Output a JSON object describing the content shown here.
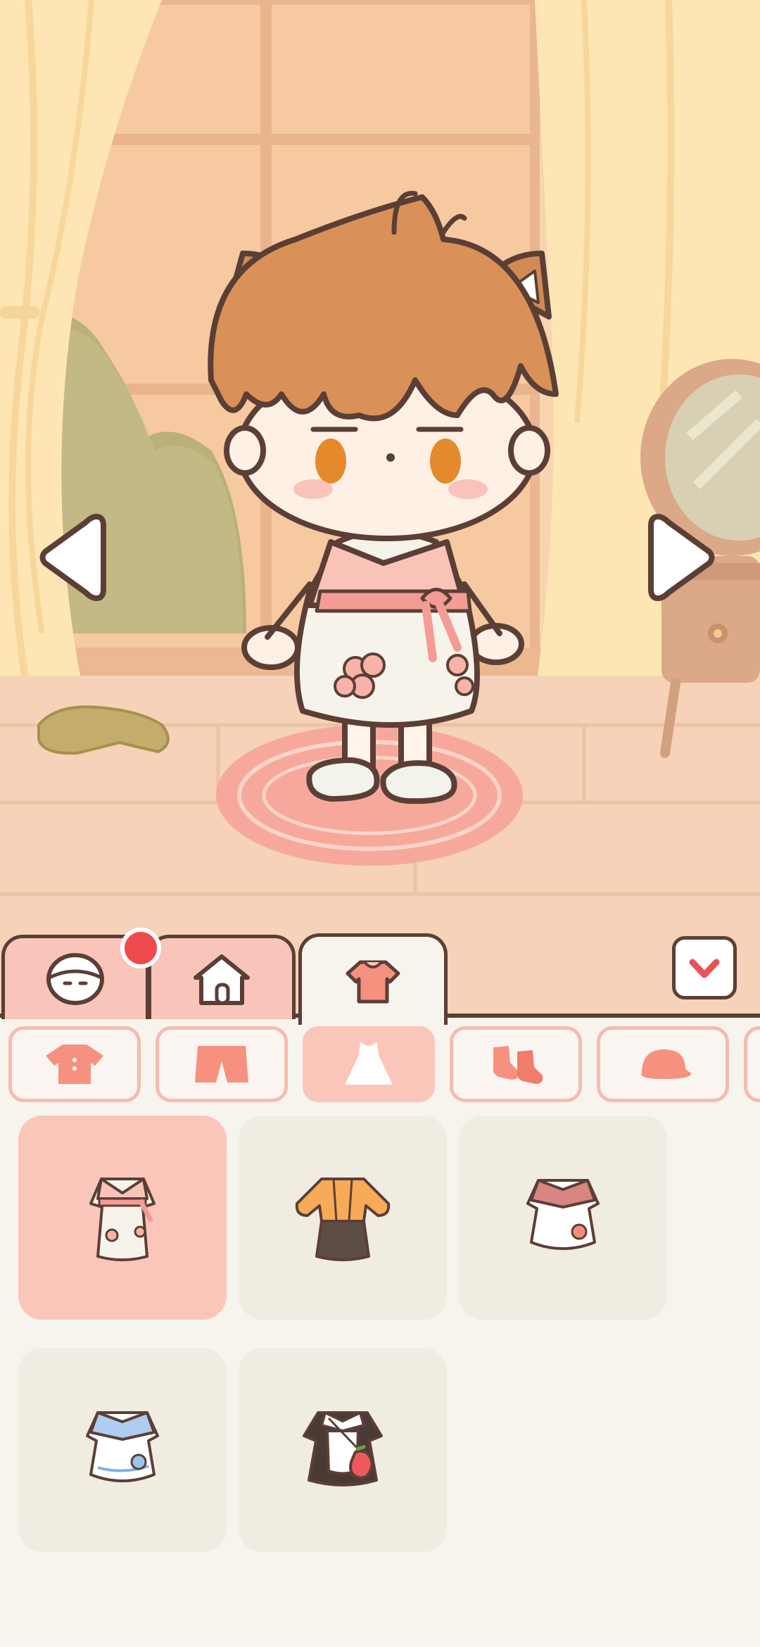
{
  "scene": {
    "icons": [
      "curtain",
      "window",
      "armchair",
      "mirror-dresser",
      "socks",
      "rug",
      "character"
    ]
  },
  "navigation": {
    "left_icon": "arrow-left-icon",
    "right_icon": "arrow-right-icon"
  },
  "tabs": [
    {
      "id": "face",
      "icon": "face-icon",
      "active": false,
      "notification": true
    },
    {
      "id": "home",
      "icon": "house-icon",
      "active": false,
      "notification": false
    },
    {
      "id": "clothes",
      "icon": "shirt-icon",
      "active": true,
      "notification": false
    }
  ],
  "collapse_button": {
    "icon": "chevron-down-icon"
  },
  "categories": [
    {
      "id": "tops",
      "icon": "tshirt-icon",
      "active": false
    },
    {
      "id": "bottoms",
      "icon": "shorts-icon",
      "active": false
    },
    {
      "id": "dresses",
      "icon": "dress-icon",
      "active": true
    },
    {
      "id": "socks",
      "icon": "socks-icon",
      "active": false
    },
    {
      "id": "hats",
      "icon": "hat-icon",
      "active": false
    }
  ],
  "items": [
    {
      "id": "hanbok-dress",
      "selected": true
    },
    {
      "id": "orange-top-dark-skirt",
      "selected": false
    },
    {
      "id": "red-collar-flower-dress",
      "selected": false
    },
    {
      "id": "blue-collar-dress",
      "selected": false
    },
    {
      "id": "maid-dress-strawberry-bag",
      "selected": false
    }
  ],
  "colors": {
    "accent": "#fbc6ba",
    "outline": "#5b3f36",
    "notification": "#ee4a4d",
    "background": "#f7f4ee",
    "item_bg": "#f1ece2"
  }
}
